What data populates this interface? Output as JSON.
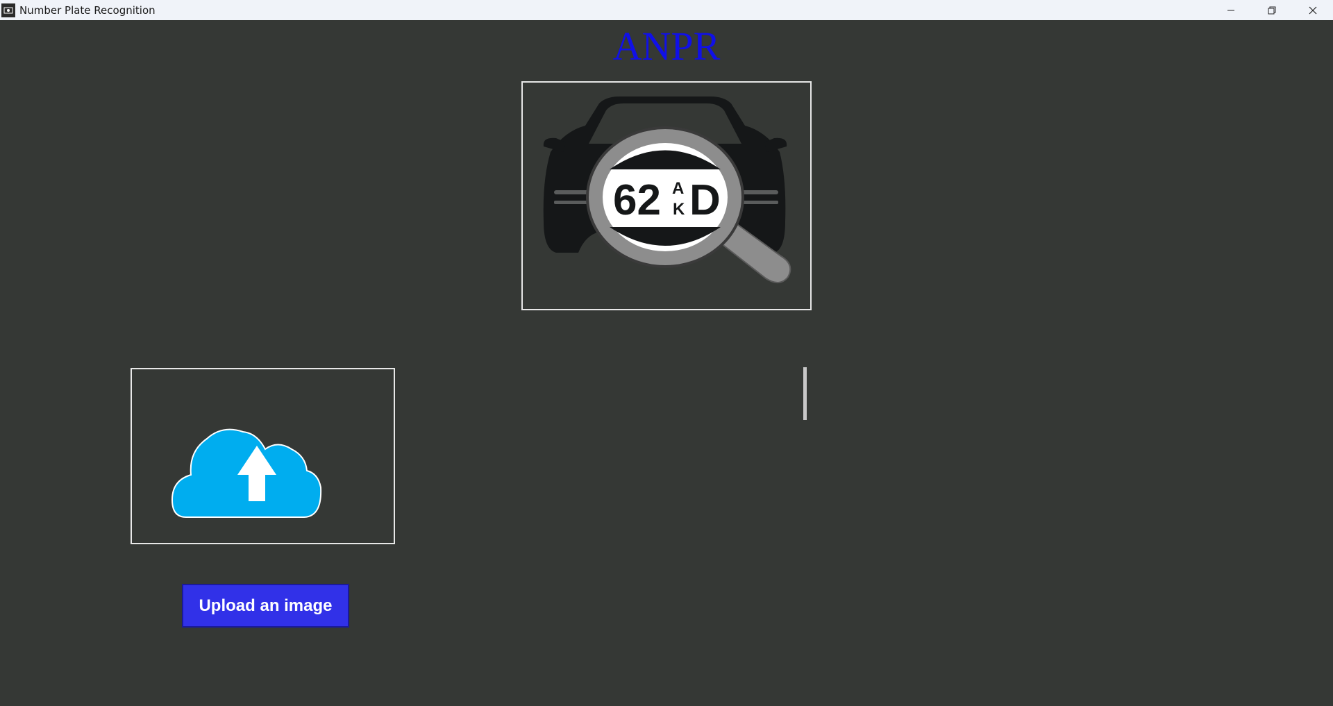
{
  "window": {
    "title": "Number Plate Recognition",
    "controls": [
      "minimize-icon",
      "restore-icon",
      "close-icon"
    ]
  },
  "main": {
    "heading": "ANPR",
    "logo": {
      "icon": "car-magnifier-plate-icon",
      "plate_text_large": "62",
      "plate_text_small_top": "A",
      "plate_text_small_bottom": "K",
      "plate_text_end": "D"
    },
    "upload_icon": "cloud-upload-icon",
    "upload_button_label": "Upload an image"
  },
  "colors": {
    "background": "#353835",
    "heading": "#1010e8",
    "button": "#3131e8",
    "cloud": "#00adef"
  }
}
